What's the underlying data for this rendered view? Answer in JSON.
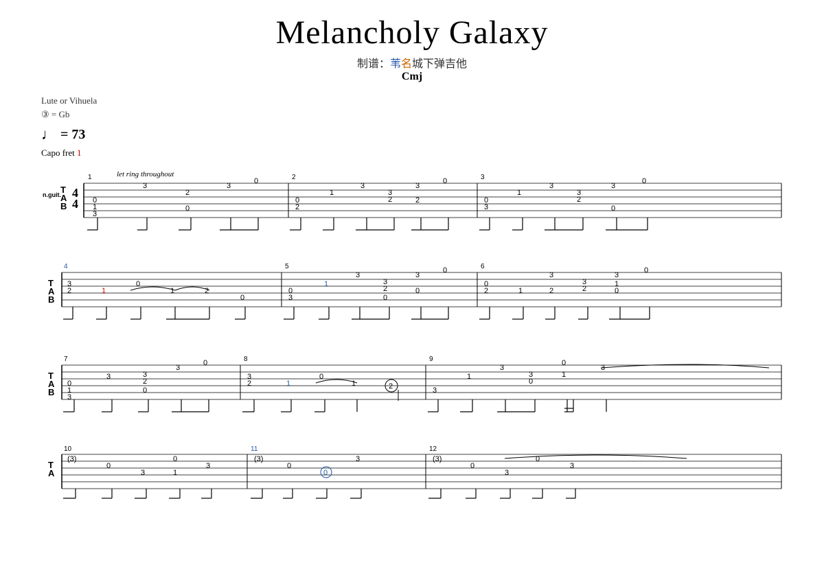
{
  "header": {
    "title": "Melancholy Galaxy",
    "subtitle_label": "制谱：",
    "subtitle_blue": "苇",
    "subtitle_orange": "名",
    "subtitle_green_part1": "城下弹吉他",
    "chord": "Cmj"
  },
  "instrument": {
    "name": "Lute or Vihuela",
    "tuning": "③ = Gb"
  },
  "tempo": {
    "bpm": "= 73"
  },
  "capo": {
    "text": "Capo fret",
    "number": "1"
  },
  "let_ring": "let ring throughout"
}
